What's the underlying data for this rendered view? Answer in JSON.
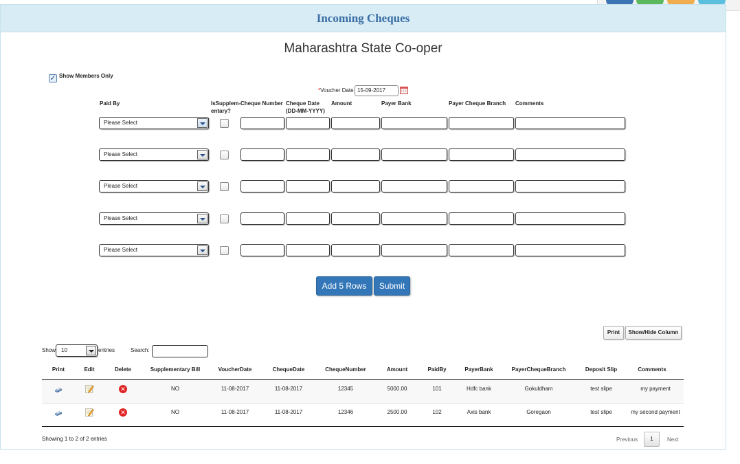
{
  "title": "Incoming Cheques",
  "society_name": "Maharashtra State Co-oper",
  "show_members_only": {
    "label": "Show Members Only",
    "checked": true
  },
  "voucher_date": {
    "label": "Voucher Date",
    "required_mark": "*",
    "value": "15-09-2017"
  },
  "form_headers": {
    "paid_by": "Paid By",
    "supplementary_1": "IsSupplem-",
    "supplementary_2": "entary?",
    "cheque_number": "Cheque Number",
    "cheque_date_1": "Cheque Date",
    "cheque_date_2": "(DD-MM-YYYY)",
    "amount": "Amount",
    "payer_bank": "Payer Bank",
    "payer_cheque_branch": "Payer Cheque Branch",
    "comments": "Comments"
  },
  "form_rows": [
    {
      "paid_by": "Please Select"
    },
    {
      "paid_by": "Please Select"
    },
    {
      "paid_by": "Please Select"
    },
    {
      "paid_by": "Please Select"
    },
    {
      "paid_by": "Please Select"
    }
  ],
  "buttons": {
    "add_rows": "Add 5 Rows",
    "submit": "Submit",
    "print": "Print",
    "show_hide": "Show/Hide Column"
  },
  "table_controls": {
    "show_label": "Show",
    "entries_value": "10",
    "entries_label": "entries",
    "search_label": "Search:"
  },
  "table": {
    "headers": [
      "Print",
      "Edit",
      "Delete",
      "Supplementary Bill",
      "VoucherDate",
      "ChequeDate",
      "ChequeNumber",
      "Amount",
      "PaidBy",
      "PayerBank",
      "PayerChequeBranch",
      "Deposit Slip",
      "Comments"
    ],
    "rows": [
      {
        "supplementary": "NO",
        "voucher_date": "11-08-2017",
        "cheque_date": "11-08-2017",
        "cheque_number": "12345",
        "amount": "5000.00",
        "paid_by": "101",
        "payer_bank": "Hdfc bank",
        "branch": "Gokuldham",
        "deposit_slip": "test slipe",
        "comments": "my payment"
      },
      {
        "supplementary": "NO",
        "voucher_date": "11-08-2017",
        "cheque_date": "11-08-2017",
        "cheque_number": "12346",
        "amount": "2500.00",
        "paid_by": "102",
        "payer_bank": "Axis bank",
        "branch": "Goregaon",
        "deposit_slip": "test slipe",
        "comments": "my second payment"
      }
    ]
  },
  "footer": {
    "info": "Showing 1 to 2 of 2 entries",
    "previous": "Previous",
    "page": "1",
    "next": "Next"
  },
  "colors": {
    "header_bg": "#d8ecf5",
    "title": "#3a6ea5",
    "button": "#3477b8",
    "delete": "#e02424"
  },
  "icons": {
    "print": "print-icon",
    "edit": "edit-icon",
    "delete": "delete-icon",
    "calendar": "calendar-icon",
    "dropdown": "chevron-down-icon"
  }
}
